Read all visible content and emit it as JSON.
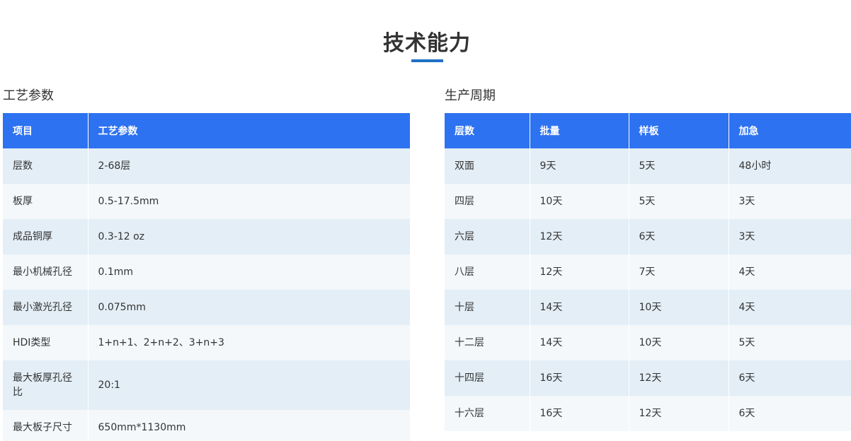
{
  "title": "技术能力",
  "colors": {
    "accent": "#1f6fc5",
    "header_bg": "#2d72f0",
    "row_odd": "#e3eef6",
    "row_even": "#f4f8fb"
  },
  "process": {
    "heading": "工艺参数",
    "columns": [
      "项目",
      "工艺参数"
    ],
    "rows": [
      [
        "层数",
        "2-68层"
      ],
      [
        "板厚",
        "0.5-17.5mm"
      ],
      [
        "成品铜厚",
        "0.3-12 oz"
      ],
      [
        "最小机械孔径",
        "0.1mm"
      ],
      [
        "最小激光孔径",
        "0.075mm"
      ],
      [
        "HDI类型",
        "1+n+1、2+n+2、3+n+3"
      ],
      [
        "最大板厚孔径比",
        "20:1"
      ],
      [
        "最大板子尺寸",
        "650mm*1130mm"
      ]
    ]
  },
  "cycle": {
    "heading": "生产周期",
    "columns": [
      "层数",
      "批量",
      "样板",
      "加急"
    ],
    "rows": [
      [
        "双面",
        "9天",
        "5天",
        "48小时"
      ],
      [
        "四层",
        "10天",
        "5天",
        "3天"
      ],
      [
        "六层",
        "12天",
        "6天",
        "3天"
      ],
      [
        "八层",
        "12天",
        "7天",
        "4天"
      ],
      [
        "十层",
        "14天",
        "10天",
        "4天"
      ],
      [
        "十二层",
        "14天",
        "10天",
        "5天"
      ],
      [
        "十四层",
        "16天",
        "12天",
        "6天"
      ],
      [
        "十六层",
        "16天",
        "12天",
        "6天"
      ]
    ]
  }
}
